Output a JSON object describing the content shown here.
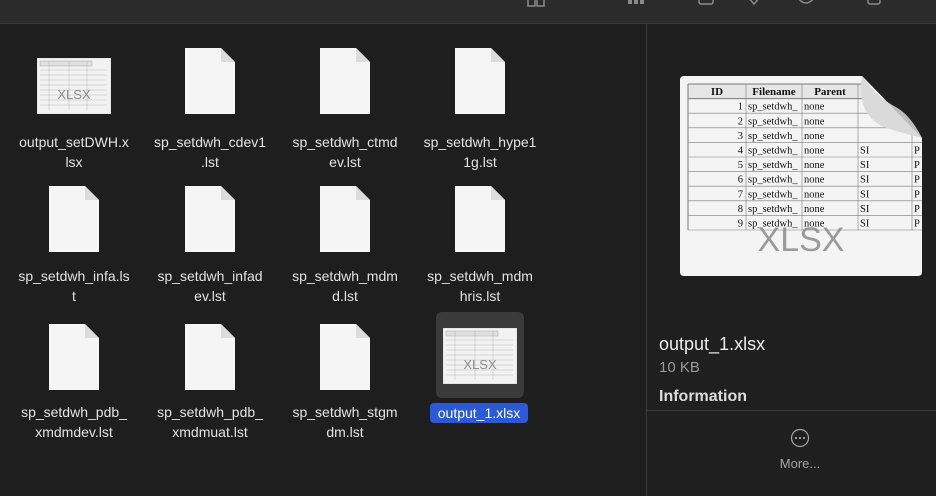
{
  "toolbar": {
    "icons": [
      "view-toggle-icon",
      "group-icon",
      "share-icon",
      "tag-icon",
      "action-icon",
      "trash-icon"
    ]
  },
  "files": [
    {
      "name_line1": "output_setDWH.x",
      "name_line2": "lsx",
      "kind": "xlsx"
    },
    {
      "name_line1": "sp_setdwh_cdev1",
      "name_line2": ".lst",
      "kind": "lst"
    },
    {
      "name_line1": "sp_setdwh_ctmd",
      "name_line2": "ev.lst",
      "kind": "lst"
    },
    {
      "name_line1": "sp_setdwh_hype1",
      "name_line2": "1g.lst",
      "kind": "lst"
    },
    {
      "name_line1": "sp_setdwh_infa.ls",
      "name_line2": "t",
      "kind": "lst"
    },
    {
      "name_line1": "sp_setdwh_infad",
      "name_line2": "ev.lst",
      "kind": "lst"
    },
    {
      "name_line1": "sp_setdwh_mdm",
      "name_line2": "d.lst",
      "kind": "lst"
    },
    {
      "name_line1": "sp_setdwh_mdm",
      "name_line2": "hris.lst",
      "kind": "lst"
    },
    {
      "name_line1": "sp_setdwh_pdb_",
      "name_line2": "xmdmdev.lst",
      "kind": "lst"
    },
    {
      "name_line1": "sp_setdwh_pdb_",
      "name_line2": "xmdmuat.lst",
      "kind": "lst"
    },
    {
      "name_line1": "sp_setdwh_stgm",
      "name_line2": "dm.lst",
      "kind": "lst"
    }
  ],
  "selected_file": {
    "name": "output_1.xlsx"
  },
  "xlsx_icon_text": "XLSX",
  "preview": {
    "file_name": "output_1.xlsx",
    "file_size": "10 KB",
    "section_title": "Information",
    "more_label": "More...",
    "sheet_headers": [
      "ID",
      "Filename",
      "Parent"
    ],
    "sheet_rows": [
      [
        "1",
        "sp_setdwh_",
        "none",
        "",
        ""
      ],
      [
        "2",
        "sp_setdwh_",
        "none",
        "",
        ""
      ],
      [
        "3",
        "sp_setdwh_",
        "none",
        "",
        ""
      ],
      [
        "4",
        "sp_setdwh_",
        "none",
        "SI",
        "P"
      ],
      [
        "5",
        "sp_setdwh_",
        "none",
        "SI",
        "P"
      ],
      [
        "6",
        "sp_setdwh_",
        "none",
        "SI",
        "P"
      ],
      [
        "7",
        "sp_setdwh_",
        "none",
        "SI",
        "P"
      ],
      [
        "8",
        "sp_setdwh_",
        "none",
        "SI",
        "P"
      ],
      [
        "9",
        "sp_setdwh_",
        "none",
        "SI",
        "P"
      ]
    ]
  },
  "colors": {
    "background": "#1e1e1e",
    "selection": "#2a5ad7",
    "selection_tile": "#3a3a3a"
  }
}
